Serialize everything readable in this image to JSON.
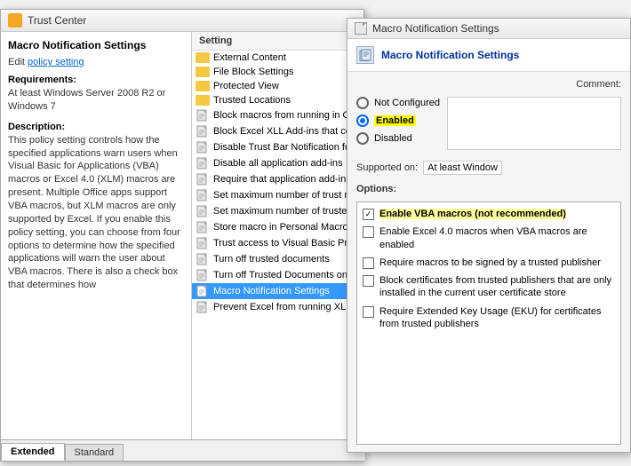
{
  "main_window": {
    "title": "Trust Center",
    "left_panel": {
      "heading": "Macro Notification Settings",
      "edit_policy_prefix": "Edit ",
      "edit_policy_link": "policy setting",
      "requirements_label": "Requirements:",
      "requirements_text": "At least Windows Server 2008 R2 or Windows 7",
      "description_label": "Description:",
      "description_text": "This policy setting controls how the specified applications warn users when Visual Basic for Applications (VBA) macros or Excel 4.0 (XLM) macros are present. Multiple Office apps support VBA macros, but XLM macros are only supported by Excel.\n\nIf you enable this policy setting, you can choose from four options to determine how the specified applications will warn the user about VBA macros. There is also a check box that determines how"
    },
    "tree_header": "Setting",
    "tree_items": [
      {
        "label": "External Content",
        "type": "folder"
      },
      {
        "label": "File Block Settings",
        "type": "folder"
      },
      {
        "label": "Protected View",
        "type": "folder"
      },
      {
        "label": "Trusted Locations",
        "type": "folder"
      },
      {
        "label": "Block macros from running in O",
        "type": "doc"
      },
      {
        "label": "Block Excel XLL Add-ins that co",
        "type": "doc"
      },
      {
        "label": "Disable Trust Bar Notification fo",
        "type": "doc"
      },
      {
        "label": "Disable all application add-ins",
        "type": "doc"
      },
      {
        "label": "Require that application add-ins",
        "type": "doc"
      },
      {
        "label": "Set maximum number of trust r",
        "type": "doc"
      },
      {
        "label": "Set maximum number of truste",
        "type": "doc"
      },
      {
        "label": "Store macro in Personal Macro",
        "type": "doc"
      },
      {
        "label": "Trust access to Visual Basic Proj",
        "type": "doc"
      },
      {
        "label": "Turn off trusted documents",
        "type": "doc"
      },
      {
        "label": "Turn off Trusted Documents on",
        "type": "doc"
      },
      {
        "label": "Macro Notification Settings",
        "type": "doc",
        "selected": true
      },
      {
        "label": "Prevent Excel from running XLM",
        "type": "doc"
      }
    ],
    "tabs": [
      {
        "label": "Extended",
        "active": true
      },
      {
        "label": "Standard",
        "active": false
      }
    ]
  },
  "policy_dialog": {
    "title": "Macro Notification Settings",
    "header_title": "Macro Notification Settings",
    "radio_options": [
      {
        "label": "Not Configured",
        "selected": false
      },
      {
        "label": "Enabled",
        "selected": true
      },
      {
        "label": "Disabled",
        "selected": false
      }
    ],
    "comment_label": "Comment:",
    "supported_on_label": "Supported on:",
    "supported_on_value": "At least Window",
    "options_label": "Options:",
    "options": [
      {
        "checked": true,
        "text": "Enable VBA macros (not recommended)",
        "highlight": true
      },
      {
        "checked": false,
        "text": "Enable Excel 4.0 macros when VBA macros are enabled"
      },
      {
        "checked": false,
        "text": "Require macros to be signed by a trusted publisher"
      },
      {
        "checked": false,
        "text": "Block certificates from trusted publishers that are only installed in the current user certificate store"
      },
      {
        "checked": false,
        "text": "Require Extended Key Usage (EKU) for certificates from trusted publishers"
      }
    ]
  }
}
